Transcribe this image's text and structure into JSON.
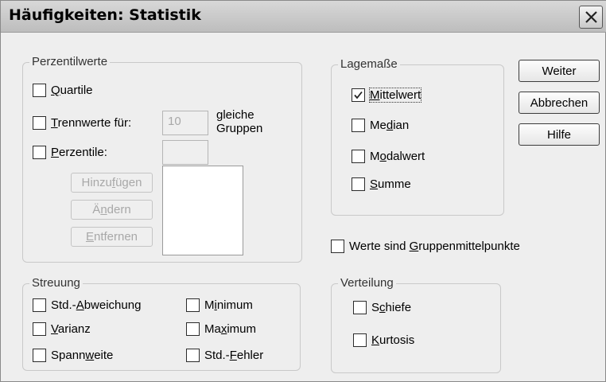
{
  "window": {
    "title": "Häufigkeiten: Statistik"
  },
  "perzentil": {
    "legend": "Perzentilwerte",
    "quartile": {
      "u": "Q",
      "rest": "uartile"
    },
    "trennwerte": {
      "u": "T",
      "rest": "rennwerte für:"
    },
    "trennwerte_value": "10",
    "gleiche1": "gleiche",
    "gleiche2": "Gruppen",
    "perzentile": {
      "u": "P",
      "rest": "erzentile:"
    },
    "hinzufuegen": {
      "pre": "Hinzu",
      "u": "f",
      "rest": "ügen"
    },
    "aendern": {
      "pre": "Ä",
      "u": "n",
      "rest": "dern"
    },
    "entfernen": {
      "pre": "",
      "u": "E",
      "rest": "ntfernen"
    }
  },
  "lage": {
    "legend": "Lagemaße",
    "mittelwert": {
      "u": "M",
      "rest": "ittelwert",
      "checked": true
    },
    "median": {
      "pre": "Me",
      "u": "d",
      "rest": "ian"
    },
    "modalwert": {
      "pre": "M",
      "u": "o",
      "rest": "dalwert"
    },
    "summe": {
      "pre": "",
      "u": "S",
      "rest": "umme"
    }
  },
  "buttons": {
    "weiter": "Weiter",
    "abbrechen": "Abbrechen",
    "hilfe": "Hilfe"
  },
  "gruppen": {
    "pre": "Werte sind ",
    "u": "G",
    "rest": "ruppenmittelpunkte"
  },
  "streuung": {
    "legend": "Streuung",
    "stdabw": {
      "pre": "Std.-",
      "u": "A",
      "rest": "bweichung"
    },
    "varianz": {
      "pre": "",
      "u": "V",
      "rest": "arianz"
    },
    "spannweite": {
      "pre": "Spann",
      "u": "w",
      "rest": "eite"
    },
    "minimum": {
      "pre": "M",
      "u": "i",
      "rest": "nimum"
    },
    "maximum": {
      "pre": "Ma",
      "u": "x",
      "rest": "imum"
    },
    "stdfehler": {
      "pre": "Std.-",
      "u": "F",
      "rest": "ehler"
    }
  },
  "verteilung": {
    "legend": "Verteilung",
    "schiefe": {
      "pre": "S",
      "u": "c",
      "rest": "hiefe"
    },
    "kurtosis": {
      "pre": "",
      "u": "K",
      "rest": "urtosis"
    }
  }
}
